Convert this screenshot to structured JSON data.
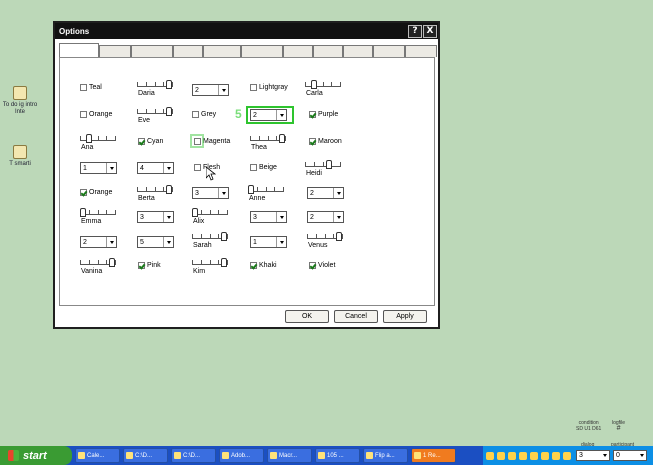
{
  "desktop": {
    "icons": [
      {
        "label": "To do ig intro Inte"
      },
      {
        "label": "T smarti"
      }
    ]
  },
  "window": {
    "title": "Options",
    "help_glyph": "?",
    "close_glyph": "X"
  },
  "tabs": {
    "count": 15
  },
  "checkboxes": {
    "teal": {
      "label": "Teal",
      "checked": false
    },
    "lightgray": {
      "label": "Lightgray",
      "checked": false
    },
    "orange1": {
      "label": "Orange",
      "checked": false
    },
    "grey": {
      "label": "Grey",
      "checked": false
    },
    "purple": {
      "label": "Purple",
      "checked": true
    },
    "cyan": {
      "label": "Cyan",
      "checked": true
    },
    "magenta": {
      "label": "Magenta",
      "checked": false
    },
    "maroon": {
      "label": "Maroon",
      "checked": true
    },
    "flesh": {
      "label": "Flesh",
      "checked": false
    },
    "beige": {
      "label": "Beige",
      "checked": false
    },
    "orange2": {
      "label": "Orange",
      "checked": true
    },
    "pink": {
      "label": "Pink",
      "checked": true
    },
    "khaki": {
      "label": "Khaki",
      "checked": true
    },
    "violet": {
      "label": "Violet",
      "checked": true
    }
  },
  "sliders": {
    "daria": {
      "label": "Daria",
      "level": 0.95
    },
    "carla": {
      "label": "Carla",
      "level": 0.2
    },
    "eve": {
      "label": "Eve",
      "level": 0.95
    },
    "ana": {
      "label": "Ana",
      "level": 0.2
    },
    "thea": {
      "label": "Thea",
      "level": 0.95
    },
    "heidi": {
      "label": "Heidi",
      "level": 0.7
    },
    "berta": {
      "label": "Berta",
      "level": 0.95
    },
    "anne": {
      "label": "Anne",
      "level": 0.0
    },
    "emma": {
      "label": "Emma",
      "level": 0.0
    },
    "alix": {
      "label": "Alix",
      "level": 0.0
    },
    "sarah": {
      "label": "Sarah",
      "level": 0.95
    },
    "venus": {
      "label": "Venus",
      "level": 0.95
    },
    "vanina": {
      "label": "Vanina",
      "level": 0.95
    },
    "kim": {
      "label": "Kim",
      "level": 0.95
    }
  },
  "dropdowns": {
    "d1": "2",
    "d2": "2",
    "d3": "1",
    "d4": "4",
    "d5": "3",
    "d6": "2",
    "d7": "3",
    "d8": "3",
    "d9": "2",
    "d10": "2",
    "d11": "5",
    "d12": "1"
  },
  "buttons": {
    "ok": "OK",
    "cancel": "Cancel",
    "apply": "Apply"
  },
  "overlays": {
    "ghost_5": "5",
    "highlight_color": "#2ec42e"
  },
  "status": {
    "condition_label": "condition",
    "condition_value": "SD U1 D61",
    "logfile_label": "logfile",
    "logfile_value": "#",
    "dialog_label": "dialog",
    "participant_label": "participant"
  },
  "taskbar": {
    "start_label": "start",
    "tasks": [
      "Cale...",
      "C:\\D...",
      "C:\\D...",
      "Adob...",
      "Macr...",
      "105 ...",
      "Flip a...",
      "1 Re..."
    ],
    "active_index": 7,
    "dialog_value": "3",
    "participant_value": "0"
  }
}
